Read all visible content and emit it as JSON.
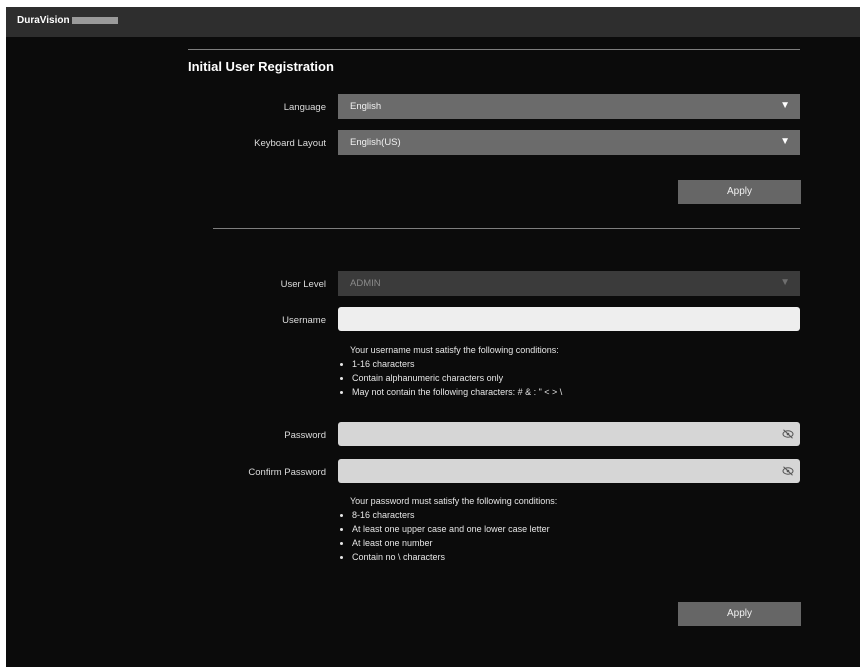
{
  "header": {
    "brand": "DuraVision"
  },
  "section_title": "Initial User Registration",
  "language": {
    "label": "Language",
    "value": "English"
  },
  "keyboard": {
    "label": "Keyboard Layout",
    "value": "English(US)"
  },
  "apply_label": "Apply",
  "user_level": {
    "label": "User Level",
    "value": "ADMIN"
  },
  "username": {
    "label": "Username",
    "value": "",
    "conditions_intro": "Your username must satisfy the following conditions:",
    "conditions": [
      "1-16 characters",
      "Contain alphanumeric characters only",
      "May not contain the following characters: # & : \" < > \\"
    ]
  },
  "password": {
    "label": "Password",
    "value": ""
  },
  "confirm_password": {
    "label": "Confirm Password",
    "value": ""
  },
  "password_conditions": {
    "intro": "Your password must satisfy the following conditions:",
    "items": [
      "8-16 characters",
      "At least one upper case and one lower case letter",
      "At least one number",
      "Contain no \\ characters"
    ]
  },
  "icons": {
    "dropdown": "triangle-down",
    "visibility": "eye-slash"
  }
}
